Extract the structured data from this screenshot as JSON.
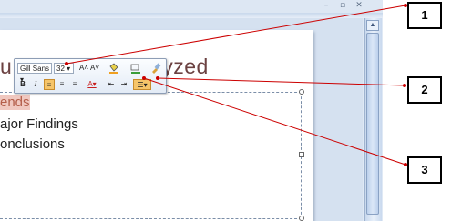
{
  "window": {
    "minimize_glyph": "–",
    "restore_glyph": "▫",
    "close_glyph": "✕"
  },
  "slide": {
    "title": "u... G... D...  Analyzed",
    "bullets": [
      "ends",
      "ajor Findings",
      "onclusions"
    ]
  },
  "mini_toolbar": {
    "font_name": "Gill Sans ▾",
    "font_size": "32 ▾",
    "row1_buttons": [
      "A˄",
      "A˅",
      "🪣▾",
      "▤▾",
      "✎"
    ],
    "row2_buttons": [
      "B",
      "I",
      "≡",
      "≡",
      "≡",
      "A▾",
      "⇤",
      "⇥",
      "☰▾"
    ]
  },
  "callouts": [
    "1",
    "2",
    "3"
  ],
  "colors": {
    "line_red": "#cc0000",
    "title_color": "#6b4141",
    "accent_orange": "#f6c56a"
  }
}
